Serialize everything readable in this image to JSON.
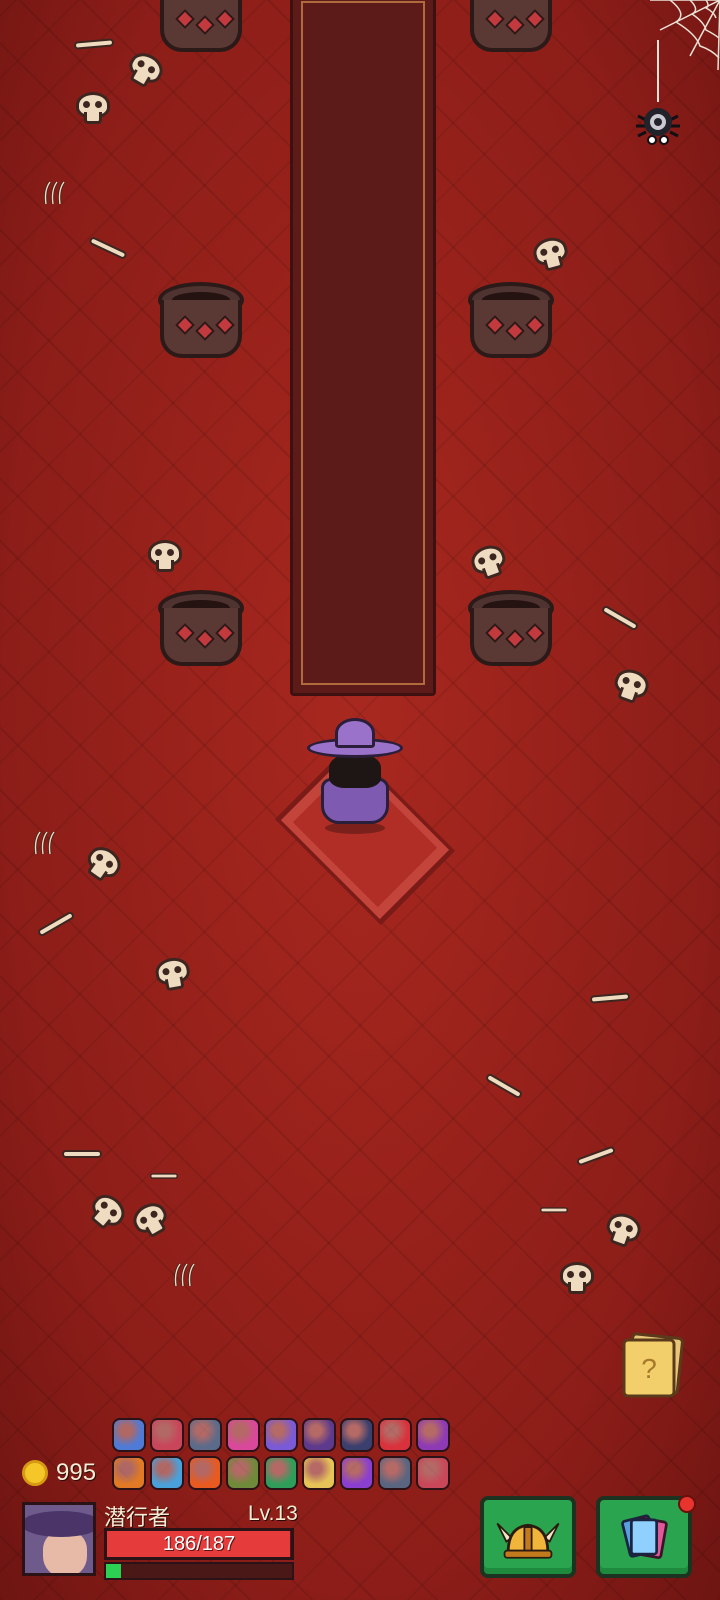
{
  "hud": {
    "coins": "995",
    "player_name": "潜行者",
    "level": "Lv.13",
    "hp_text": "186/187",
    "hp_fraction": 0.995,
    "xp_fraction": 0.08
  },
  "icons": {
    "settings": "gear-spider-icon",
    "quest": "question-scroll-icon",
    "coin": "coin-icon",
    "hero_button": "viking-helmet-icon",
    "cards_button": "cards-icon"
  },
  "buffs": [
    {
      "name": "blue-mushroom",
      "color": "#4f7bd6"
    },
    {
      "name": "bear-trap",
      "color": "#c9455a"
    },
    {
      "name": "shield-sword",
      "color": "#5c6b8a"
    },
    {
      "name": "pink-demon",
      "color": "#d9489b"
    },
    {
      "name": "purple-swirl",
      "color": "#7a5ad6"
    },
    {
      "name": "bat-crystal",
      "color": "#5e3a8c"
    },
    {
      "name": "ghost-bat",
      "color": "#3a3f6e"
    },
    {
      "name": "red-devil",
      "color": "#d9323c"
    },
    {
      "name": "golden-halo",
      "color": "#8e3ab5"
    },
    {
      "name": "fire-boots",
      "color": "#e07a24"
    },
    {
      "name": "potion-vial",
      "color": "#4aa0d9"
    },
    {
      "name": "fire-burst",
      "color": "#e85a1f"
    },
    {
      "name": "iron-gauntlet",
      "color": "#6f8a3a"
    },
    {
      "name": "green-orb",
      "color": "#2f9e5a"
    },
    {
      "name": "golden-bone",
      "color": "#e6c457"
    },
    {
      "name": "purple-shield-badge",
      "color": "#8b3fd1"
    },
    {
      "name": "hex-gem",
      "color": "#5a6680"
    },
    {
      "name": "heart-lock",
      "color": "#c8485a"
    }
  ],
  "colors": {
    "floor": "#9a231d",
    "hp": "#e63b3b",
    "xp": "#2cd154",
    "button": "#2aa44e"
  }
}
